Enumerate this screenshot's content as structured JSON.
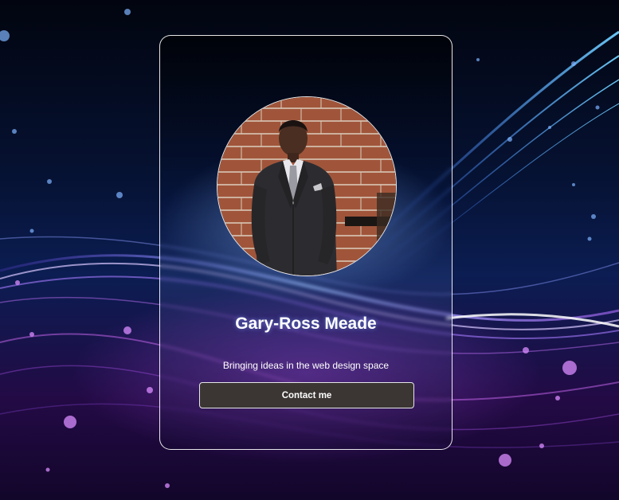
{
  "profile": {
    "name": "Gary-Ross Meade",
    "tagline": "Bringing ideas in the web design space",
    "contact_label": "Contact me"
  },
  "colors": {
    "button_bg": "#3b3634",
    "card_border": "#ffffff",
    "text": "#ffffff"
  }
}
